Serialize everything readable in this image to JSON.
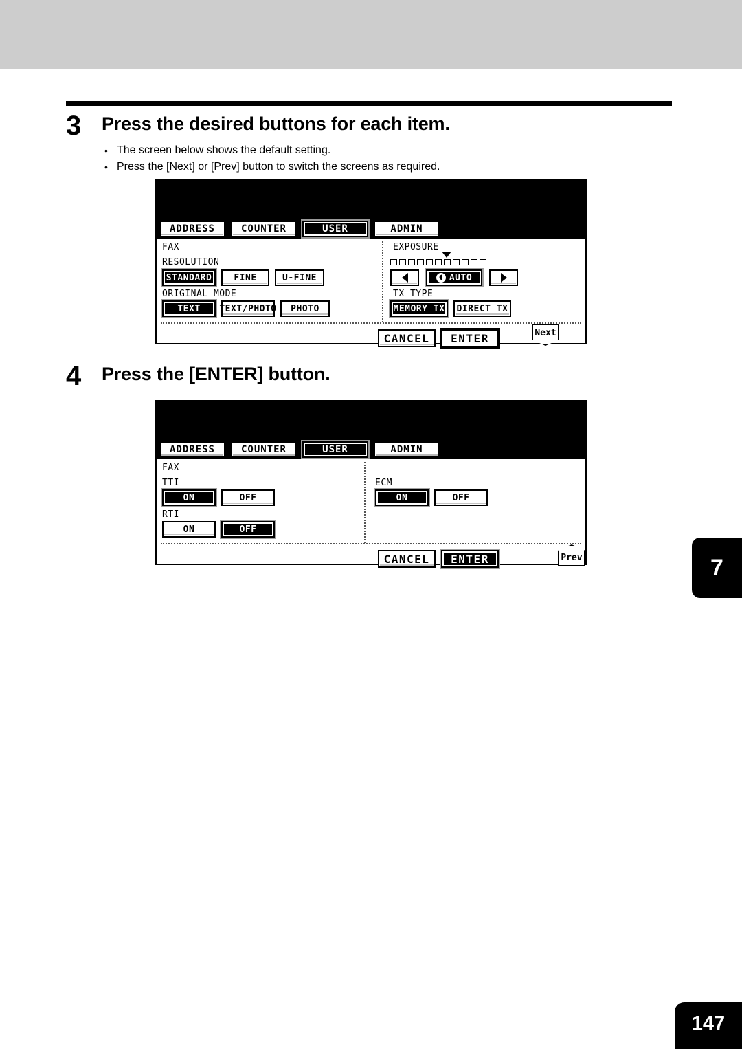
{
  "page": {
    "chapter_tab": "7",
    "page_number": "147"
  },
  "steps": [
    {
      "number": "3",
      "title": "Press the desired buttons for each item.",
      "bullets": [
        "The screen below shows the default setting.",
        "Press the [Next] or [Prev] button to switch the screens as required."
      ]
    },
    {
      "number": "4",
      "title": "Press the [ENTER] button.",
      "bullets": []
    }
  ],
  "screen1": {
    "tabs": [
      {
        "label": "ADDRESS",
        "selected": false
      },
      {
        "label": "COUNTER",
        "selected": false
      },
      {
        "label": "USER",
        "selected": true
      },
      {
        "label": "ADMIN",
        "selected": false
      }
    ],
    "mode_label": "FAX",
    "left": {
      "resolution": {
        "label": "RESOLUTION",
        "options": [
          {
            "label": "STANDARD",
            "selected": true
          },
          {
            "label": "FINE",
            "selected": false
          },
          {
            "label": "U-FINE",
            "selected": false
          }
        ]
      },
      "original_mode": {
        "label": "ORIGINAL MODE",
        "options": [
          {
            "label": "TEXT",
            "selected": true
          },
          {
            "label": "TEXT/PHOTO",
            "selected": false
          },
          {
            "label": "PHOTO",
            "selected": false
          }
        ]
      }
    },
    "right": {
      "exposure": {
        "label": "EXPOSURE",
        "steps": 11,
        "marker_index": 5,
        "decrease_icon": "arrow-left-icon",
        "increase_icon": "arrow-right-icon",
        "auto_label": "AUTO",
        "auto_selected": true
      },
      "tx_type": {
        "label": "TX TYPE",
        "options": [
          {
            "label": "MEMORY TX",
            "selected": true
          },
          {
            "label": "DIRECT TX",
            "selected": false
          }
        ]
      }
    },
    "footer": {
      "cancel_label": "CANCEL",
      "enter_label": "ENTER",
      "enter_selected": false,
      "nav_label": "Next"
    }
  },
  "screen2": {
    "tabs": [
      {
        "label": "ADDRESS",
        "selected": false
      },
      {
        "label": "COUNTER",
        "selected": false
      },
      {
        "label": "USER",
        "selected": true
      },
      {
        "label": "ADMIN",
        "selected": false
      }
    ],
    "mode_label": "FAX",
    "left": {
      "tti": {
        "label": "TTI",
        "options": [
          {
            "label": "ON",
            "selected": true
          },
          {
            "label": "OFF",
            "selected": false
          }
        ]
      },
      "rti": {
        "label": "RTI",
        "options": [
          {
            "label": "ON",
            "selected": false
          },
          {
            "label": "OFF",
            "selected": true
          }
        ]
      }
    },
    "right": {
      "ecm": {
        "label": "ECM",
        "options": [
          {
            "label": "ON",
            "selected": true
          },
          {
            "label": "OFF",
            "selected": false
          }
        ]
      }
    },
    "footer": {
      "cancel_label": "CANCEL",
      "enter_label": "ENTER",
      "enter_selected": true,
      "nav_label": "Prev"
    }
  }
}
